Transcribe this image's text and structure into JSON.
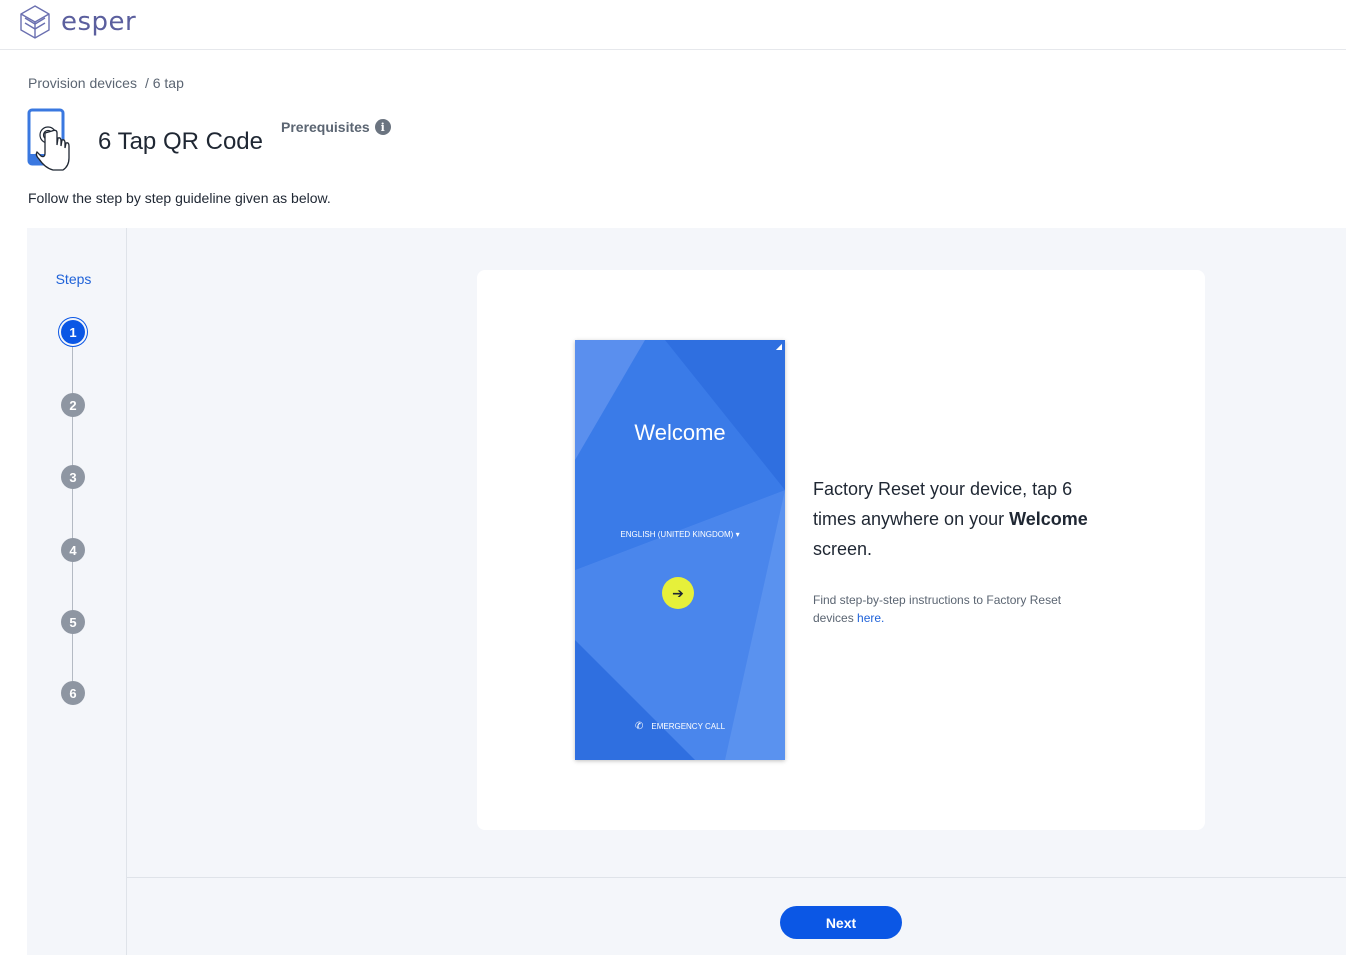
{
  "app": {
    "brand": "esper"
  },
  "breadcrumb": {
    "parent": "Provision devices",
    "current": "/ 6 tap"
  },
  "header": {
    "title": "6 Tap QR Code",
    "prerequisites_label": "Prerequisites",
    "info_glyph": "i"
  },
  "guideline": "Follow the step by step guideline given as below.",
  "steps": {
    "title": "Steps",
    "items": [
      "1",
      "2",
      "3",
      "4",
      "5",
      "6"
    ],
    "active_index": 0
  },
  "phone_screen": {
    "welcome": "Welcome",
    "language": "ENGLISH (UNITED KINGDOM)",
    "emergency": "EMERGENCY CALL"
  },
  "instruction": {
    "text_before": "Factory Reset your device, tap 6 times anywhere on your ",
    "bold": "Welcome",
    "text_after": " screen."
  },
  "note": {
    "text": "Find step-by-step instructions to Factory Reset devices ",
    "link": "here."
  },
  "actions": {
    "next_label": "Next"
  },
  "colors": {
    "primary": "#0b57e5",
    "phone_blue": "#2f6fe0",
    "accent_yellow": "#e6f03a",
    "brand": "#5b5f9e"
  },
  "icons": {
    "logo": "esper-logo-icon",
    "device": "tap-device-icon",
    "info": "info-icon",
    "arrow": "arrow-right-icon",
    "phone": "phone-icon",
    "dropdown": "caret-down-icon"
  }
}
